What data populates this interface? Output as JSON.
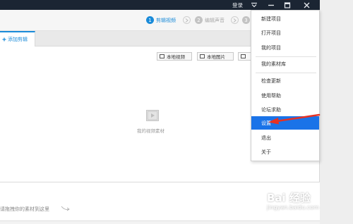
{
  "titlebar": {
    "login": "登录",
    "colors": {
      "bg": "#1b2533",
      "fg": "#e6e9ee"
    }
  },
  "steps": [
    {
      "num": "1",
      "label": "剪辑视频",
      "active": true
    },
    {
      "num": "2",
      "label": "编辑声音",
      "active": false
    },
    {
      "num": "3",
      "label": "",
      "active": false
    }
  ],
  "tab": {
    "label": "添加剪辑"
  },
  "import_buttons": [
    {
      "label": "本地视频",
      "icon": "film-icon"
    },
    {
      "label": "本地图片",
      "icon": "image-icon"
    },
    {
      "label": "",
      "icon": "film-icon"
    }
  ],
  "empty_state": {
    "label": "我的视频素材"
  },
  "timeline": {
    "drop_hint": "请拖拽你的素材到这里"
  },
  "menu": {
    "items": [
      {
        "label": "新建项目"
      },
      {
        "label": "打开项目"
      },
      {
        "label": "我的项目"
      },
      {
        "label": "我的素材库"
      },
      {
        "label": "检查更新"
      },
      {
        "label": "使用帮助"
      },
      {
        "label": "论坛求助"
      },
      {
        "label": "设置",
        "highlighted": true
      },
      {
        "label": "退出"
      },
      {
        "label": "关于"
      }
    ],
    "highlight_color": "#1a73e8"
  },
  "annotation": {
    "arrow_color": "#e63223"
  },
  "watermark": {
    "brand": "Bai 经验",
    "url": "jingyan.baidu.com"
  },
  "accent_color": "#1a8bd9"
}
